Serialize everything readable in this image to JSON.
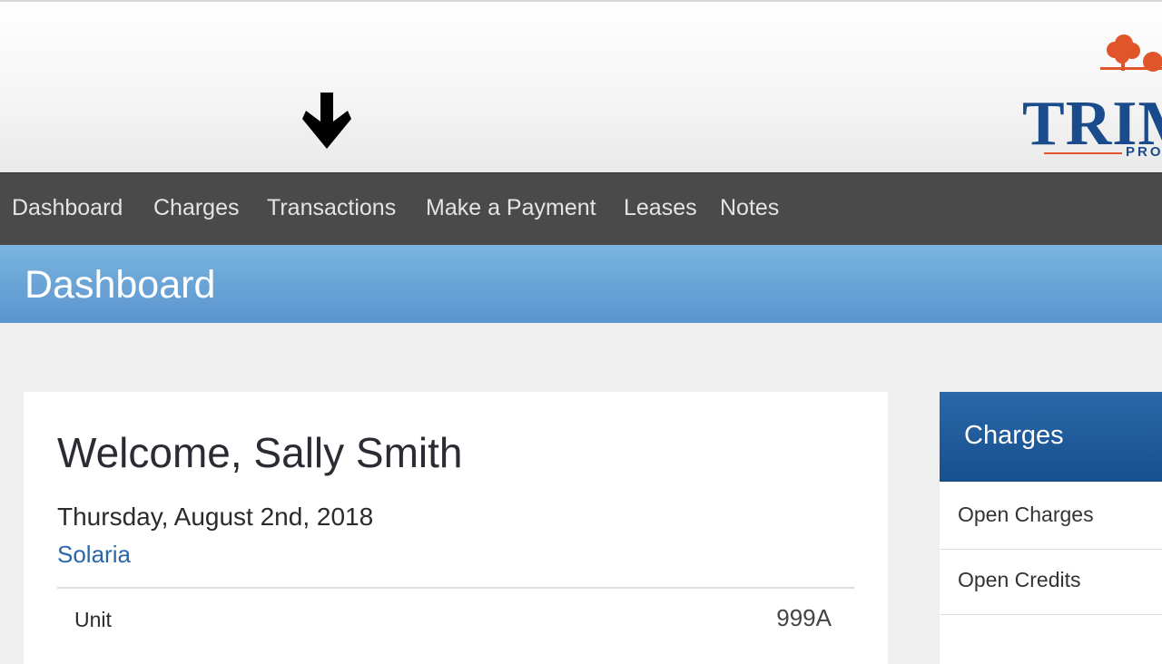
{
  "logo": {
    "text": "TRIM",
    "subtext": "PRO"
  },
  "nav": {
    "items": [
      {
        "label": "Dashboard"
      },
      {
        "label": "Charges"
      },
      {
        "label": "Transactions"
      },
      {
        "label": "Make a Payment"
      },
      {
        "label": "Leases"
      },
      {
        "label": "Notes"
      }
    ]
  },
  "page": {
    "title": "Dashboard"
  },
  "welcome_card": {
    "greeting": "Welcome, Sally Smith",
    "date": "Thursday, August 2nd, 2018",
    "property": "Solaria",
    "unit_label": "Unit",
    "unit_value": "999A"
  },
  "charges_panel": {
    "title": "Charges",
    "links": [
      {
        "label": "Open Charges"
      },
      {
        "label": "Open Credits"
      }
    ]
  },
  "colors": {
    "nav_bg": "#4a4a4a",
    "title_bar": "#6aa5d8",
    "panel_header": "#1f5b9c",
    "link": "#2a66a8",
    "logo_blue": "#1a4b8c",
    "logo_orange": "#e0552a"
  },
  "icons": {
    "annotation_arrow": "arrow-down-icon",
    "logo_tree": "tree-icon"
  }
}
